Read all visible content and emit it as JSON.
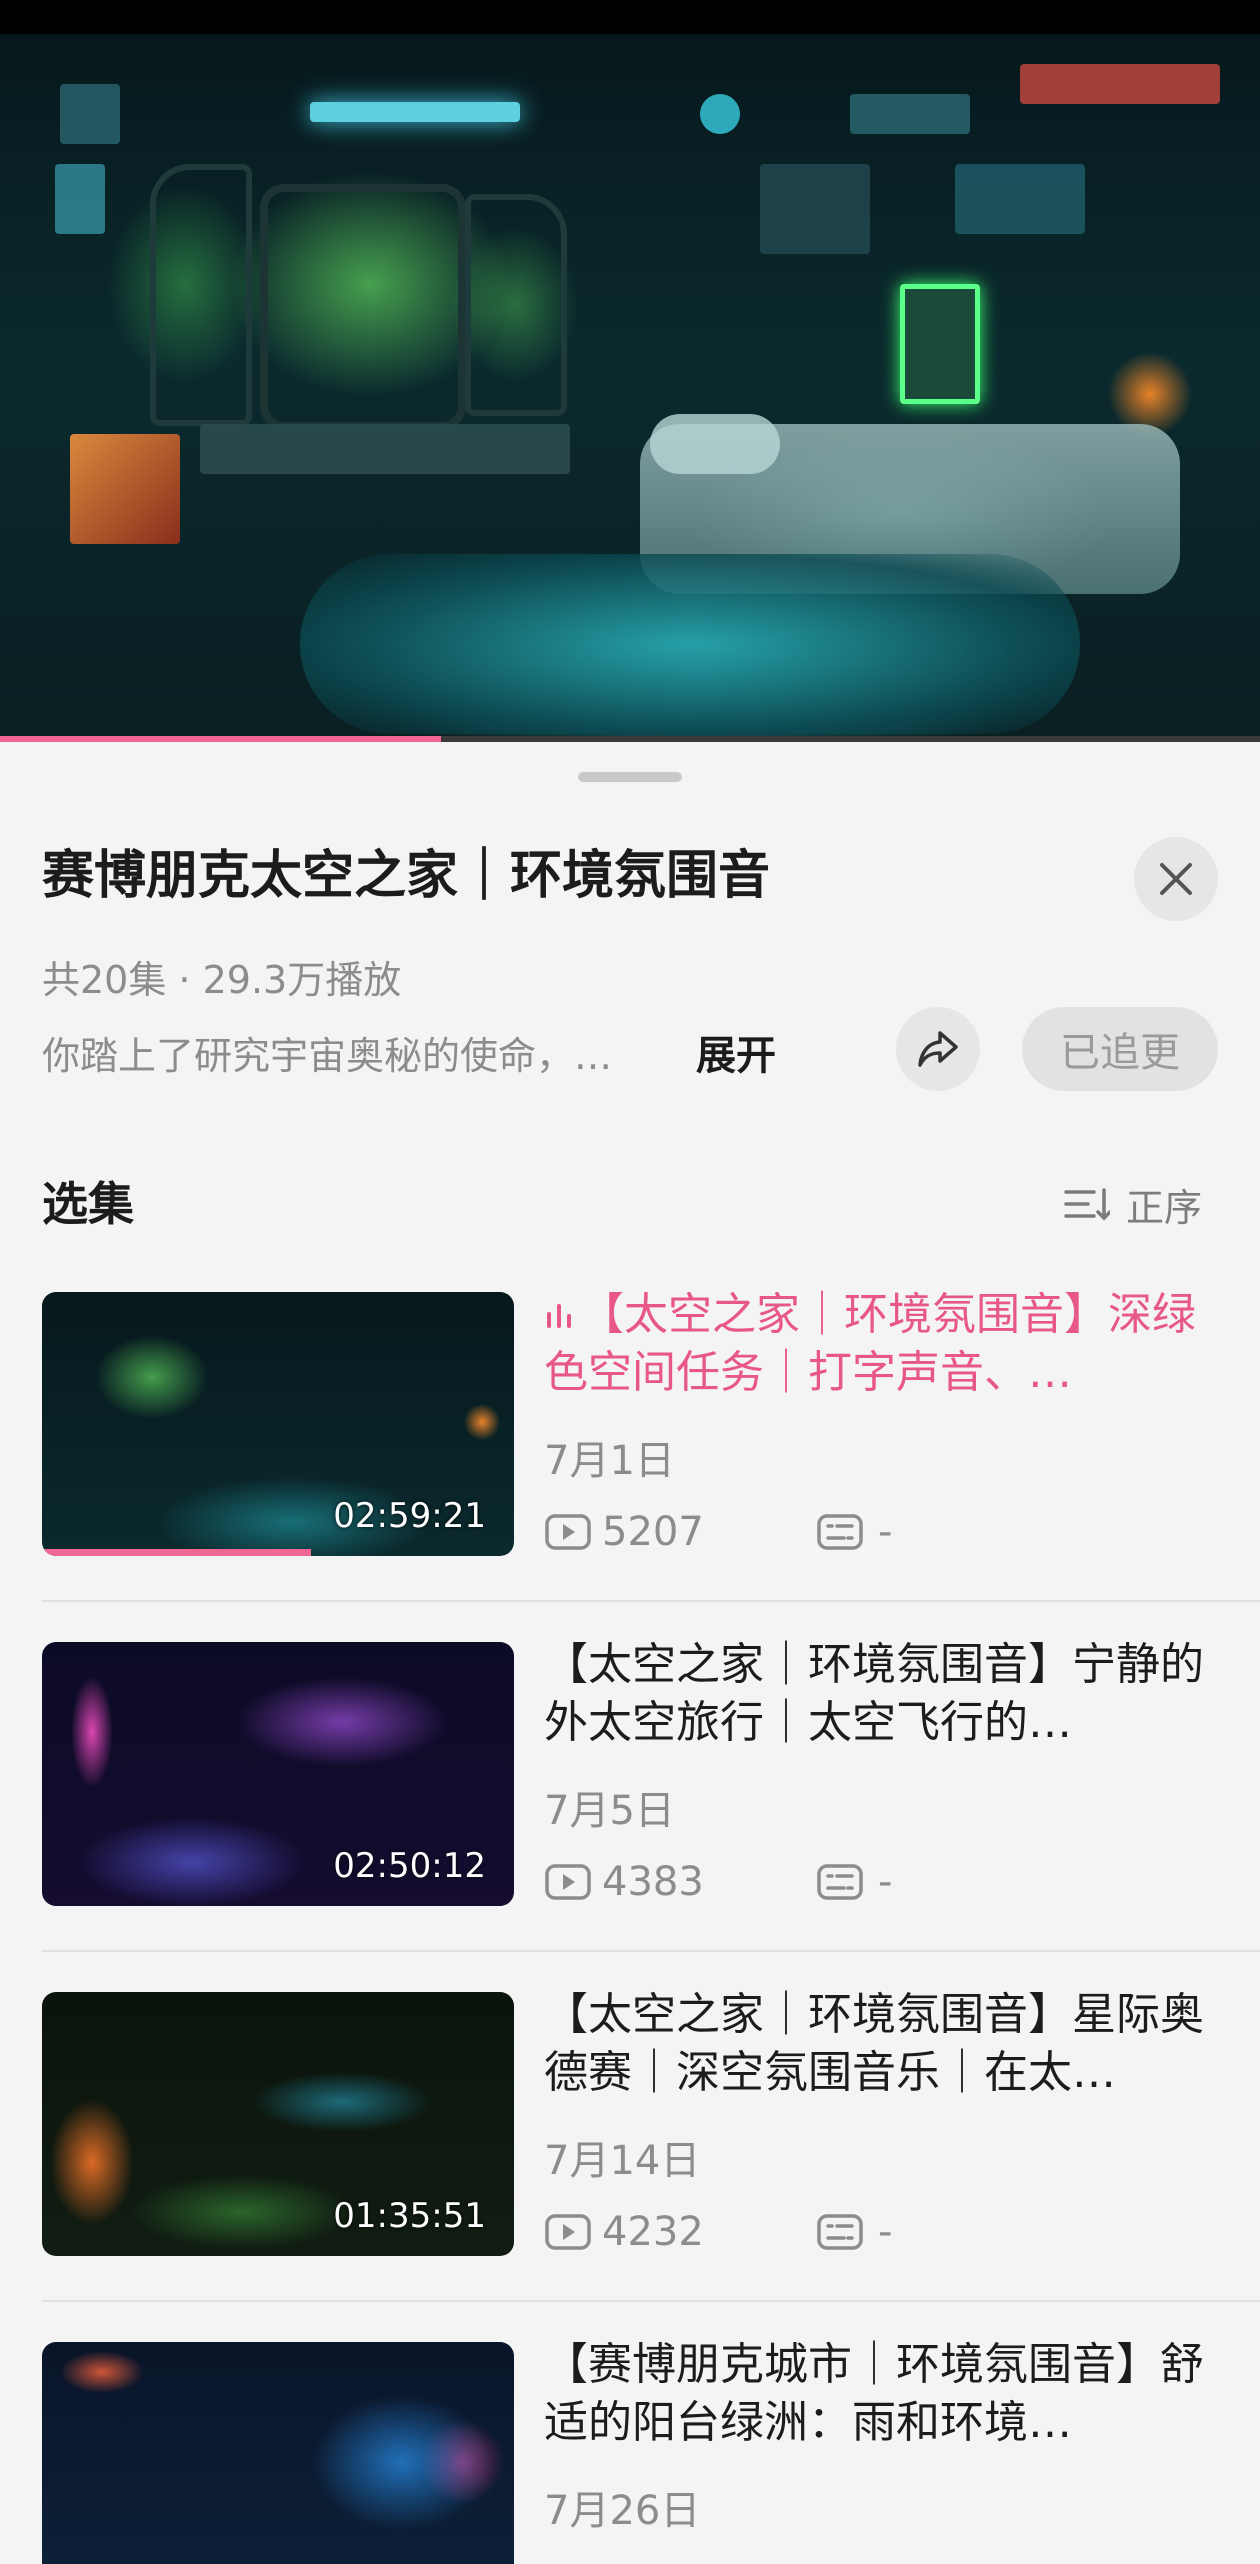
{
  "player": {
    "progress_fraction": 0.35
  },
  "series": {
    "title": "赛博朋克太空之家｜环境氛围音",
    "meta": "共20集 · 29.3万播放",
    "description": "你踏上了研究宇宙奥秘的使命，…",
    "expand_label": "展开",
    "follow_label": "已追更"
  },
  "episodes_section": {
    "label": "选集",
    "sort_label": "正序"
  },
  "episodes": [
    {
      "title": "【太空之家｜环境氛围音】深绿色空间任务｜打字声音、…",
      "date": "7月1日",
      "plays": "5207",
      "danmaku": "-",
      "duration": "02:59:21",
      "active": true,
      "watched_fraction": 0.57
    },
    {
      "title": "【太空之家｜环境氛围音】宁静的外太空旅行｜太空飞行的…",
      "date": "7月5日",
      "plays": "4383",
      "danmaku": "-",
      "duration": "02:50:12",
      "active": false
    },
    {
      "title": "【太空之家｜环境氛围音】星际奥德赛｜深空氛围音乐｜在太…",
      "date": "7月14日",
      "plays": "4232",
      "danmaku": "-",
      "duration": "01:35:51",
      "active": false
    },
    {
      "title": "【赛博朋克城市｜环境氛围音】舒适的阳台绿洲：雨和环境…",
      "date": "7月26日",
      "active": false
    }
  ],
  "colors": {
    "accent": "#f06793",
    "active_title": "#e8578a",
    "background": "#f4f4f4"
  }
}
